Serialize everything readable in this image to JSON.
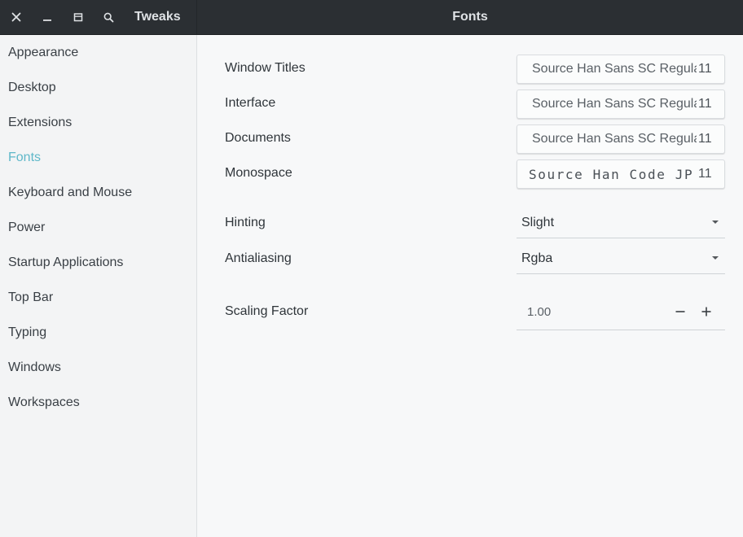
{
  "window": {
    "app_title": "Tweaks",
    "page_title": "Fonts"
  },
  "sidebar": {
    "items": [
      {
        "label": "Appearance"
      },
      {
        "label": "Desktop"
      },
      {
        "label": "Extensions"
      },
      {
        "label": "Fonts",
        "active": true
      },
      {
        "label": "Keyboard and Mouse"
      },
      {
        "label": "Power"
      },
      {
        "label": "Startup Applications"
      },
      {
        "label": "Top Bar"
      },
      {
        "label": "Typing"
      },
      {
        "label": "Windows"
      },
      {
        "label": "Workspaces"
      }
    ]
  },
  "fonts": {
    "window_titles": {
      "label": "Window Titles",
      "font": "Source Han Sans SC Regular",
      "size": "11"
    },
    "interface": {
      "label": "Interface",
      "font": "Source Han Sans SC Regular",
      "size": "11"
    },
    "documents": {
      "label": "Documents",
      "font": "Source Han Sans SC Regular",
      "size": "11"
    },
    "monospace": {
      "label": "Monospace",
      "font": "Source Han Code JP M",
      "size": "11"
    }
  },
  "hinting": {
    "label": "Hinting",
    "value": "Slight"
  },
  "antialiasing": {
    "label": "Antialiasing",
    "value": "Rgba"
  },
  "scaling": {
    "label": "Scaling Factor",
    "value": "1.00"
  },
  "colors": {
    "accent": "#5fb8c9",
    "headerbar": "#2b2f33",
    "background": "#f6f7f8"
  },
  "icons": {
    "close": "close-icon",
    "minimize": "minimize-icon",
    "restore": "restore-icon",
    "search": "search-icon",
    "combo_arrow": "dropdown-arrow-icon",
    "decrease": "minus-icon",
    "increase": "plus-icon"
  }
}
